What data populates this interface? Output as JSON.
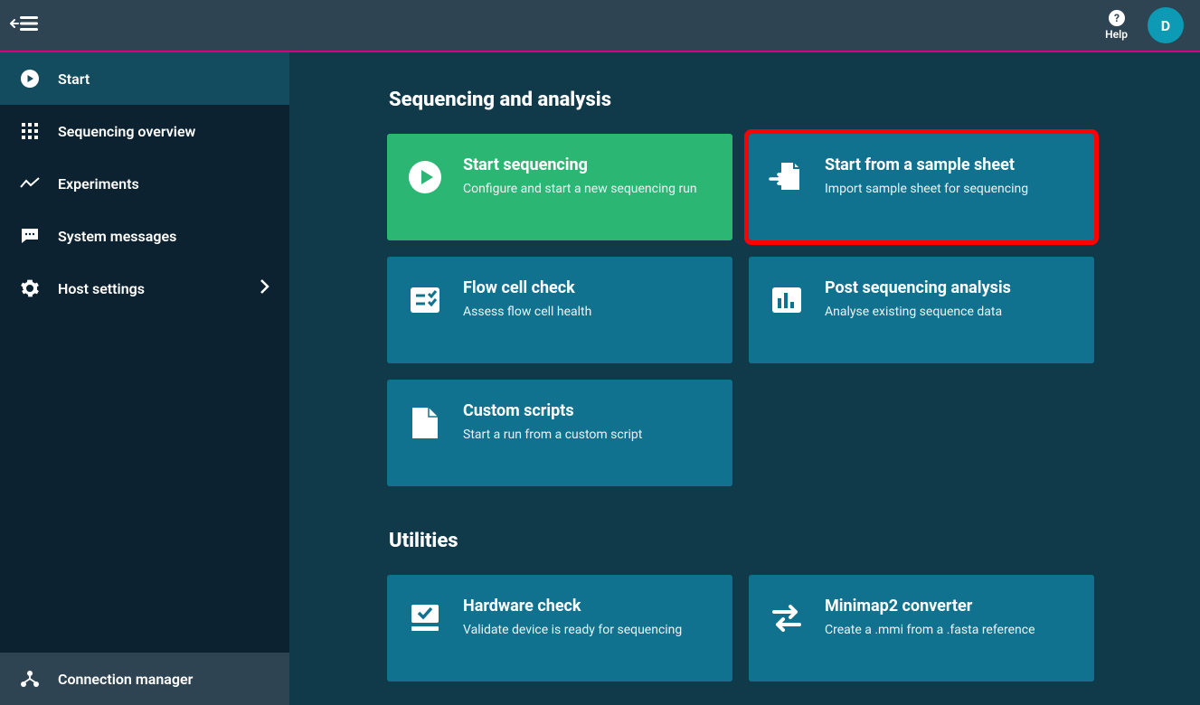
{
  "topbar": {
    "help_label": "Help",
    "avatar_letter": "D"
  },
  "sidebar": {
    "items": [
      {
        "label": "Start",
        "active": true
      },
      {
        "label": "Sequencing overview"
      },
      {
        "label": "Experiments"
      },
      {
        "label": "System messages"
      },
      {
        "label": "Host settings",
        "chevron": true
      }
    ],
    "footer": {
      "label": "Connection manager"
    }
  },
  "sections": {
    "seq": {
      "title": "Sequencing and analysis",
      "cards": [
        {
          "title": "Start sequencing",
          "sub": "Configure and start a new sequencing run"
        },
        {
          "title": "Start from a sample sheet",
          "sub": "Import sample sheet for sequencing"
        },
        {
          "title": "Flow cell check",
          "sub": "Assess flow cell health"
        },
        {
          "title": "Post sequencing analysis",
          "sub": "Analyse existing sequence data"
        },
        {
          "title": "Custom scripts",
          "sub": "Start a run from a custom script"
        }
      ]
    },
    "util": {
      "title": "Utilities",
      "cards": [
        {
          "title": "Hardware check",
          "sub": "Validate device is ready for sequencing"
        },
        {
          "title": "Minimap2 converter",
          "sub": "Create a .mmi from a .fasta reference"
        }
      ]
    }
  }
}
